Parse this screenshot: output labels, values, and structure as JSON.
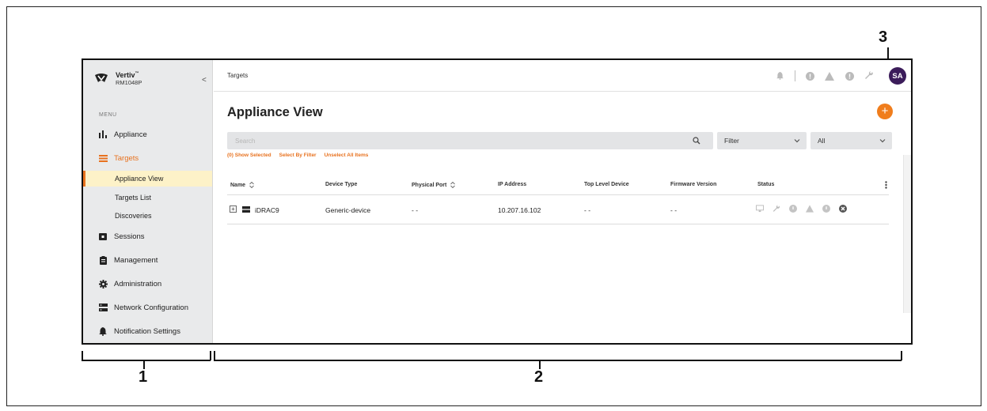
{
  "brand": {
    "name": "Vertiv",
    "tm": "™",
    "model": "RM1048P"
  },
  "sidebar": {
    "collapse_glyph": "<",
    "menu_label": "MENU",
    "items": [
      {
        "label": "Appliance",
        "icon": "bar-chart-icon"
      },
      {
        "label": "Targets",
        "icon": "list-icon",
        "active": true,
        "children": [
          {
            "label": "Appliance View",
            "selected": true
          },
          {
            "label": "Targets List"
          },
          {
            "label": "Discoveries"
          }
        ]
      },
      {
        "label": "Sessions",
        "icon": "monitor-icon"
      },
      {
        "label": "Management",
        "icon": "clipboard-icon"
      },
      {
        "label": "Administration",
        "icon": "gear-icon"
      },
      {
        "label": "Network Configuration",
        "icon": "network-icon"
      },
      {
        "label": "Notification Settings",
        "icon": "bell-icon"
      }
    ]
  },
  "header": {
    "breadcrumb": "Targets",
    "user_initials": "SA"
  },
  "page": {
    "title": "Appliance View",
    "add_glyph": "+",
    "search_placeholder": "Search",
    "filter_label": "Filter",
    "all_label": "All",
    "links": {
      "show_selected": "(0) Show Selected",
      "select_by_filter": "Select By Filter",
      "unselect_all": "Unselect All Items"
    }
  },
  "table": {
    "columns": [
      "Name",
      "Device Type",
      "Physical Port",
      "IP Address",
      "Top Level Device",
      "Firmware Version",
      "Status"
    ],
    "rows": [
      {
        "expand": "+",
        "name": "iDRAC9",
        "device_type": "Generic-device",
        "physical_port": "- -",
        "ip_address": "10.207.16.102",
        "top_level_device": "- -",
        "firmware_version": "- -"
      }
    ]
  },
  "annotations": {
    "sidebar": "1",
    "main": "2",
    "avatar": "3"
  },
  "colors": {
    "accent": "#e8721f",
    "sidebar_bg": "#e9eaeb",
    "avatar_bg": "#3b1c5a",
    "selected_bg": "#fdf2c8"
  }
}
